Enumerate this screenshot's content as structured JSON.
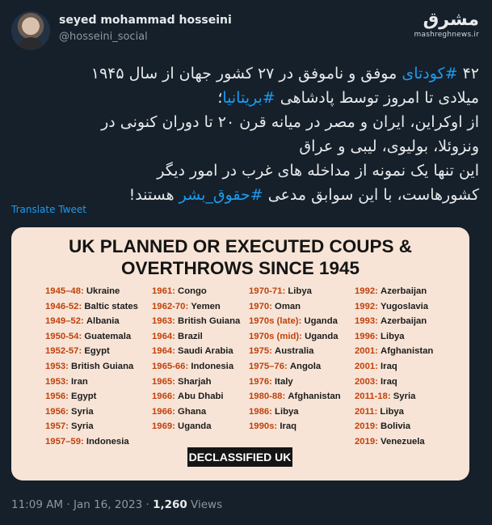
{
  "header": {
    "name": "seyed mohammad hosseini",
    "handle": "@hosseini_social",
    "watermark_logo": "مشرق",
    "watermark_url": "mashreghnews.ir"
  },
  "tweet": {
    "line1_pre": "۴۲ ",
    "line1_tag": "#کودتای",
    "line1_post": " موفق و ناموفق در ۲۷ کشور جهان از سال ۱۹۴۵",
    "line2_pre": "میلادی تا امروز توسط پادشاهی ",
    "line2_tag": "#بریتانیا",
    "line2_post": "؛",
    "line3": "از اوکراین، ایران و مصر در میانه قرن ۲۰ تا دوران کنونی در",
    "line4": "ونزوئلا، بولیوی، لیبی و عراق",
    "line5": "این تنها یک نمونه از مداخله های غرب در امور دیگر",
    "line6_pre": "کشورهاست، با این سوابق مدعی ",
    "line6_tag": "#حقوق_بشر",
    "line6_post": " هستند!"
  },
  "translate_label": "Translate Tweet",
  "card": {
    "title_line1": "UK PLANNED OR EXECUTED COUPS &",
    "title_line2": "OVERTHROWS SINCE 1945",
    "columns": [
      [
        {
          "year": "1945–48:",
          "country": "Ukraine"
        },
        {
          "year": "1946-52:",
          "country": "Baltic states"
        },
        {
          "year": "1949–52:",
          "country": "Albania"
        },
        {
          "year": "1950-54:",
          "country": "Guatemala"
        },
        {
          "year": "1952-57:",
          "country": "Egypt"
        },
        {
          "year": "1953:",
          "country": "British Guiana"
        },
        {
          "year": "1953:",
          "country": "Iran"
        },
        {
          "year": "1956:",
          "country": "Egypt"
        },
        {
          "year": "1956:",
          "country": "Syria"
        },
        {
          "year": "1957:",
          "country": "Syria"
        },
        {
          "year": "1957–59:",
          "country": "Indonesia"
        }
      ],
      [
        {
          "year": "1961:",
          "country": "Congo"
        },
        {
          "year": "1962-70:",
          "country": "Yemen"
        },
        {
          "year": "1963:",
          "country": "British Guiana"
        },
        {
          "year": "1964:",
          "country": "Brazil"
        },
        {
          "year": "1964:",
          "country": "Saudi Arabia"
        },
        {
          "year": "1965-66:",
          "country": "Indonesia"
        },
        {
          "year": "1965:",
          "country": "Sharjah"
        },
        {
          "year": "1966:",
          "country": "Abu Dhabi"
        },
        {
          "year": "1966:",
          "country": "Ghana"
        },
        {
          "year": "1969:",
          "country": "Uganda"
        }
      ],
      [
        {
          "year": "1970-71:",
          "country": "Libya"
        },
        {
          "year": "1970:",
          "country": "Oman"
        },
        {
          "year": "1970s (late):",
          "country": "Uganda"
        },
        {
          "year": "1970s (mid):",
          "country": "Uganda"
        },
        {
          "year": "1975:",
          "country": "Australia"
        },
        {
          "year": "1975–76:",
          "country": "Angola"
        },
        {
          "year": "1976:",
          "country": "Italy"
        },
        {
          "year": "1980-88:",
          "country": "Afghanistan"
        },
        {
          "year": "1986:",
          "country": "Libya"
        },
        {
          "year": "1990s:",
          "country": "Iraq"
        }
      ],
      [
        {
          "year": "1992:",
          "country": "Azerbaijan"
        },
        {
          "year": "1992:",
          "country": "Yugoslavia"
        },
        {
          "year": "1993:",
          "country": "Azerbaijan"
        },
        {
          "year": "1996:",
          "country": "Libya"
        },
        {
          "year": "2001:",
          "country": "Afghanistan"
        },
        {
          "year": "2001:",
          "country": "Iraq"
        },
        {
          "year": "2003:",
          "country": "Iraq"
        },
        {
          "year": "2011-18:",
          "country": "Syria"
        },
        {
          "year": "2011:",
          "country": "Libya"
        },
        {
          "year": "2019:",
          "country": "Bolivia"
        },
        {
          "year": "2019:",
          "country": "Venezuela"
        }
      ]
    ],
    "badge": "DECLASSIFIED UK"
  },
  "meta": {
    "time": "11:09 AM",
    "sep": " · ",
    "date": "Jan 16, 2023",
    "sep2": " · ",
    "views_count": "1,260",
    "views_label": " Views"
  }
}
